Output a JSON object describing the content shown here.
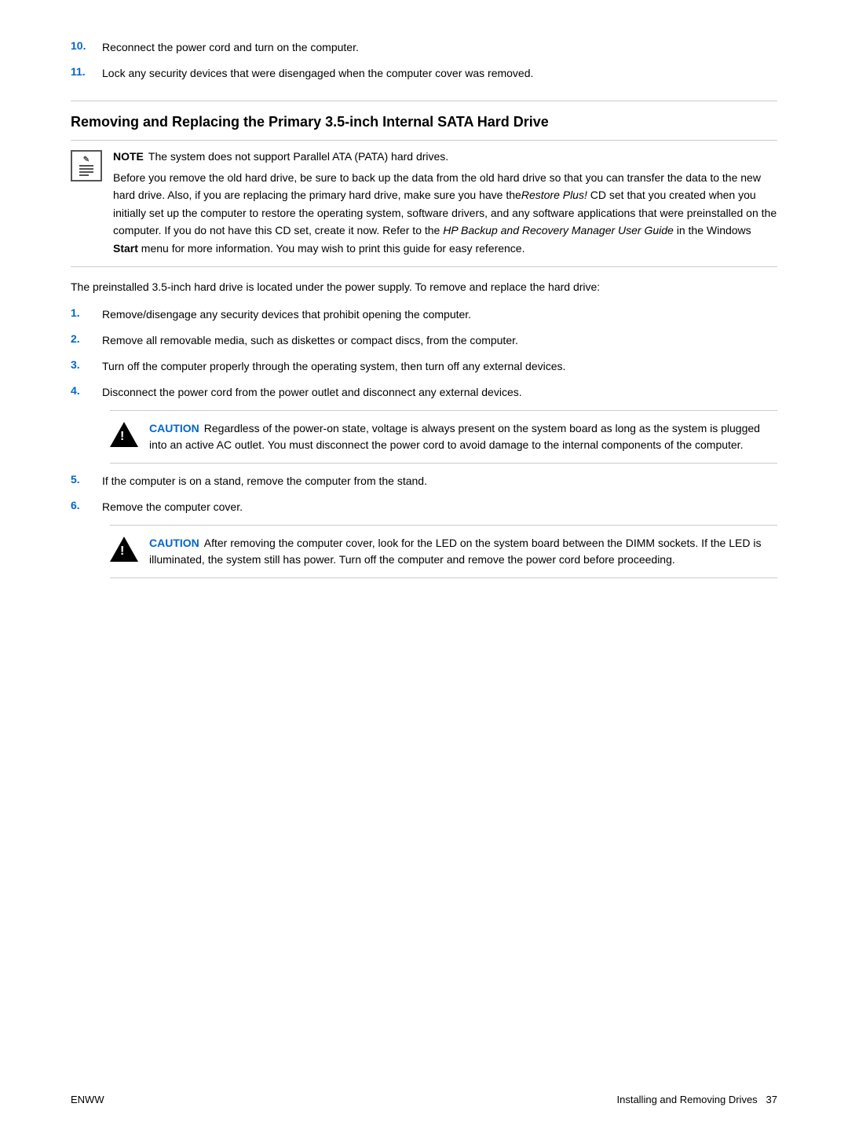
{
  "page": {
    "footer": {
      "left": "ENWW",
      "right_label": "Installing and Removing Drives",
      "page_num": "37"
    }
  },
  "top_steps": [
    {
      "num": "10.",
      "text": "Reconnect the power cord and turn on the computer."
    },
    {
      "num": "11.",
      "text": "Lock any security devices that were disengaged when the computer cover was removed."
    }
  ],
  "section": {
    "title": "Removing and Replacing the Primary 3.5-inch Internal SATA Hard Drive"
  },
  "note": {
    "label": "NOTE",
    "text": "The system does not support Parallel ATA (PATA) hard drives."
  },
  "note_body": {
    "text_plain_1": "Before you remove the old hard drive, be sure to back up the data from the old hard drive so that you can transfer the data to the new hard drive. Also, if you are replacing the primary hard drive, make sure you have the",
    "text_italic": "Restore Plus!",
    "text_plain_2": " CD set that you created when you initially set up the computer to restore the operating system, software drivers, and any software applications that were preinstalled on the computer. If you do not have this CD set, create it now. Refer to the ",
    "text_italic_2": "HP Backup and Recovery Manager User Guide",
    "text_plain_3": " in the Windows ",
    "text_bold": "Start",
    "text_plain_4": " menu for more information. You may wish to print this guide for easy reference."
  },
  "intro": "The preinstalled 3.5-inch hard drive is located under the power supply. To remove and replace the hard drive:",
  "steps": [
    {
      "num": "1.",
      "text": "Remove/disengage any security devices that prohibit opening the computer."
    },
    {
      "num": "2.",
      "text": "Remove all removable media, such as diskettes or compact discs, from the computer."
    },
    {
      "num": "3.",
      "text": "Turn off the computer properly through the operating system, then turn off any external devices."
    },
    {
      "num": "4.",
      "text": "Disconnect the power cord from the power outlet and disconnect any external devices."
    }
  ],
  "caution1": {
    "label": "CAUTION",
    "text": "Regardless of the power-on state, voltage is always present on the system board as long as the system is plugged into an active AC outlet. You must disconnect the power cord to avoid damage to the internal components of the computer."
  },
  "steps2": [
    {
      "num": "5.",
      "text": "If the computer is on a stand, remove the computer from the stand."
    },
    {
      "num": "6.",
      "text": "Remove the computer cover."
    }
  ],
  "caution2": {
    "label": "CAUTION",
    "text": "After removing the computer cover, look for the LED on the system board between the DIMM sockets. If the LED is illuminated, the system still has power. Turn off the computer and remove the power cord before proceeding."
  }
}
